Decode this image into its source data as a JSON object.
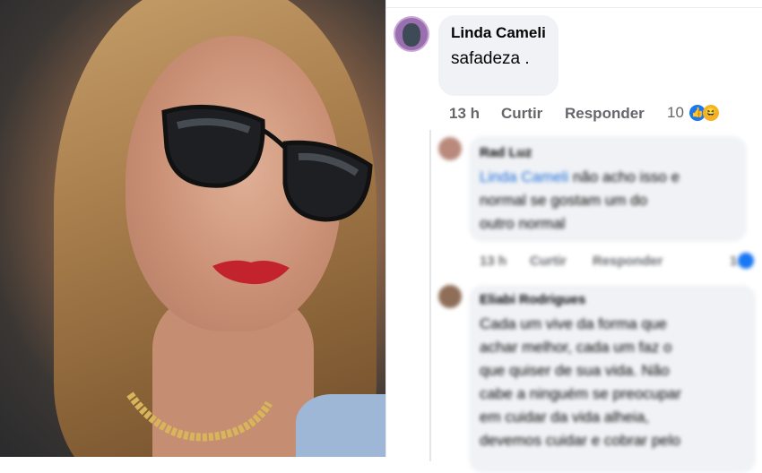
{
  "comment": {
    "author": "Linda Cameli",
    "text": "safadeza .",
    "time": "13 h",
    "like_label": "Curtir",
    "reply_label": "Responder",
    "reaction_count": "10"
  },
  "replies": [
    {
      "author": "Rad Luz",
      "mention": "Linda Cameli",
      "lines": [
        "não acho isso e",
        "normal se gostam um do",
        "outro normal"
      ],
      "time": "13 h",
      "like_label": "Curtir",
      "reply_label": "Responder",
      "reaction_count": "1"
    },
    {
      "author": "Eliabi Rodrigues",
      "lines": [
        "Cada um vive da forma que",
        "achar melhor, cada um faz o",
        "que quiser de sua vida. Não",
        "cabe a ninguém se preocupar",
        "em cuidar da vida alheia,",
        "devemos cuidar e cobrar pelo"
      ]
    }
  ],
  "colors": {
    "link": "#216fdb",
    "like": "#1877f2",
    "haha": "#f7b125",
    "bubble": "#f0f2f5",
    "meta": "#65676b"
  }
}
